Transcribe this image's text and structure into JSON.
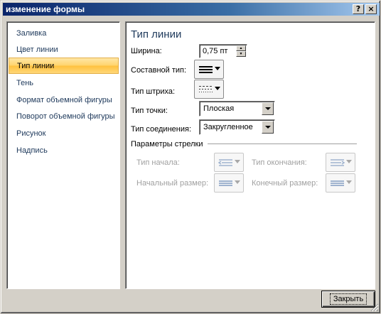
{
  "window": {
    "title": "изменение формы"
  },
  "titlebar": {
    "help": "?",
    "close": "×"
  },
  "sidebar": {
    "items": [
      {
        "label": "Заливка"
      },
      {
        "label": "Цвет линии"
      },
      {
        "label": "Тип линии",
        "selected": true
      },
      {
        "label": "Тень"
      },
      {
        "label": "Формат объемной фигуры"
      },
      {
        "label": "Поворот объемной фигуры"
      },
      {
        "label": "Рисунок"
      },
      {
        "label": "Надпись"
      }
    ]
  },
  "main": {
    "title": "Тип линии",
    "width_label": "Ширина:",
    "width_value": "0,75 пт",
    "compound_label": "Составной тип:",
    "dash_label": "Тип штриха:",
    "cap_label": "Тип точки:",
    "cap_value": "Плоская",
    "join_label": "Тип соединения:",
    "join_value": "Закругленное",
    "arrow_group_label": "Параметры стрелки",
    "begin_type_label": "Тип начала:",
    "end_type_label": "Тип окончания:",
    "begin_size_label": "Начальный размер:",
    "end_size_label": "Конечный размер:"
  },
  "footer": {
    "close_label": "Закрыть"
  },
  "colors": {
    "selection": "#ffd36b",
    "title_gradient_start": "#0a246a",
    "nav_text": "#1e395b"
  }
}
